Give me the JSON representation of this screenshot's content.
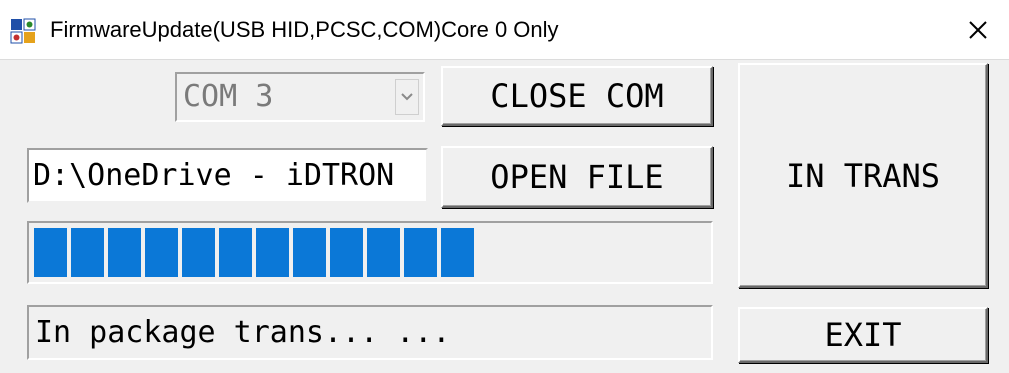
{
  "window": {
    "title": "FirmwareUpdate(USB HID,PCSC,COM)Core 0 Only",
    "app_icon": "firmware-app-icon",
    "close_icon": "close-icon",
    "title_bar_color": "#ffffff",
    "close_hover_color": "#e81123"
  },
  "com_select": {
    "selected": "COM 3",
    "enabled": false,
    "arrow_icon": "chevron-down-icon"
  },
  "buttons": {
    "close_com": "CLOSE COM",
    "open_file": "OPEN FILE",
    "in_trans": "IN TRANS",
    "exit": "EXIT"
  },
  "file_path": {
    "value": "D:\\OneDrive - iDTRON"
  },
  "progress": {
    "percent": 68,
    "color": "#0b78d7"
  },
  "status": {
    "text": "In package trans... ..."
  }
}
